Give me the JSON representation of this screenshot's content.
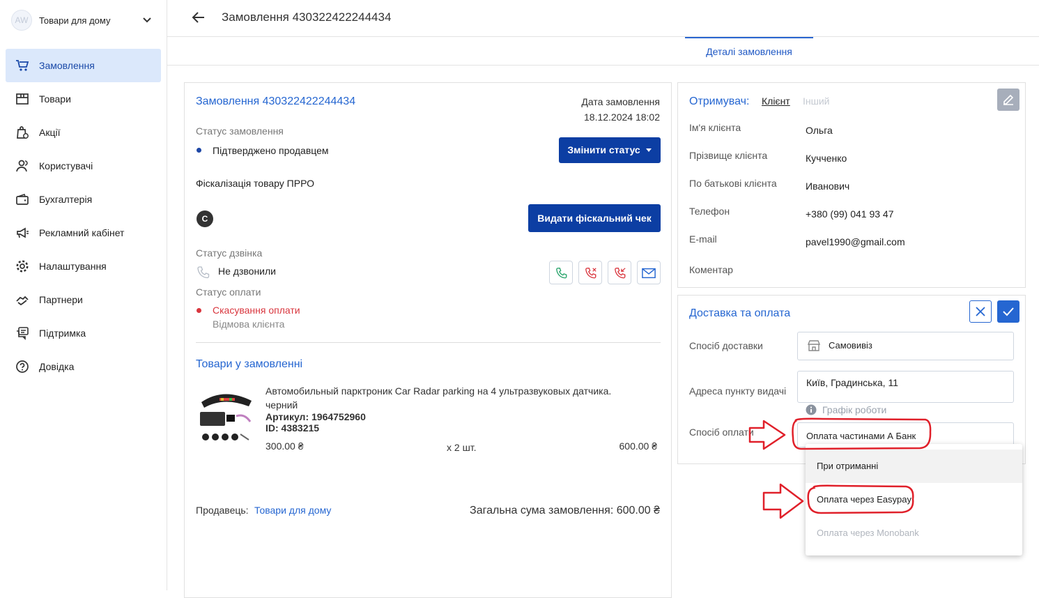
{
  "store": {
    "avatar_initials": "AW",
    "name": "Товари для дому"
  },
  "sidebar": {
    "items": [
      {
        "label": "Замовлення",
        "icon": "cart-icon",
        "active": true
      },
      {
        "label": "Товари",
        "icon": "box-icon"
      },
      {
        "label": "Акції",
        "icon": "discount-bag-icon"
      },
      {
        "label": "Користувачі",
        "icon": "users-icon"
      },
      {
        "label": "Бухгалтерія",
        "icon": "wallet-icon"
      },
      {
        "label": "Рекламний кабінет",
        "icon": "megaphone-icon"
      },
      {
        "label": "Налаштування",
        "icon": "gear-icon"
      },
      {
        "label": "Партнери",
        "icon": "handshake-icon"
      },
      {
        "label": "Підтримка",
        "icon": "chat-icon"
      },
      {
        "label": "Довідка",
        "icon": "help-icon"
      }
    ]
  },
  "header": {
    "title": "Замовлення 430322422244434"
  },
  "tabs": {
    "active": "Деталі замовлення"
  },
  "order": {
    "title": "Замовлення 430322422244434",
    "date_label": "Дата замовлення",
    "date_value": "18.12.2024 18:02",
    "status_label": "Статус замовлення",
    "status_value": "Підтверджено продавцем",
    "change_status_button": "Змінити статус",
    "fiscal_label": "Фіскалізація товару ПРРО",
    "fiscal_badge": "C",
    "fiscal_button": "Видати фіскальний чек",
    "call_status_label": "Статус дзвінка",
    "call_status_value": "Не дзвонили",
    "payment_status_label": "Статус оплати",
    "payment_status_value": "Скасування оплати",
    "payment_status_reason": "Відмова клієнта",
    "goods_title": "Товари у замовленні",
    "product": {
      "name": "Автомобильный парктроник Car Radar parking на 4 ультразвуковых датчика. черний",
      "article": "Артикул: 1964752960",
      "id": "ID: 4383215",
      "price": "300.00 ₴",
      "qty": "x 2 шт.",
      "total": "600.00 ₴"
    },
    "seller_label": "Продавець:",
    "seller_name": "Товари для дому",
    "total_label": "Загальна сума замовлення: 600.00 ₴"
  },
  "recipient": {
    "label": "Отримувач:",
    "tab_client": "Клієнт",
    "tab_other": "Інший",
    "fields": [
      {
        "label": "Ім'я клієнта",
        "value": "Ольга"
      },
      {
        "label": "Прізвище клієнта",
        "value": "Кучченко"
      },
      {
        "label": "По батькові клієнта",
        "value": "Иванович"
      },
      {
        "label": "Телефон",
        "value": "+380 (99) 041 93 47"
      },
      {
        "label": "E-mail",
        "value": "pavel1990@gmail.com"
      },
      {
        "label": "Коментар",
        "value": ""
      }
    ]
  },
  "delivery": {
    "title": "Доставка та оплата",
    "method_label": "Спосіб доставки",
    "method_value": "Самовивіз",
    "address_label": "Адреса пункту видачі",
    "address_value": "Київ, Градинська, 11",
    "schedule_link": "Графік роботи",
    "payment_label": "Спосіб оплати",
    "payment_value": "Оплата частинами А Банк"
  },
  "dropdown": {
    "options": [
      {
        "label": "При отриманні",
        "state": "hover"
      },
      {
        "label": "Оплата через Easypay",
        "state": "normal"
      },
      {
        "label": "Оплата через Monobank",
        "state": "disabled"
      }
    ]
  },
  "colors": {
    "accent": "#2566d1",
    "primary_button": "#0c3ea3",
    "annotation": "#e0202a",
    "error": "#d9363e"
  }
}
